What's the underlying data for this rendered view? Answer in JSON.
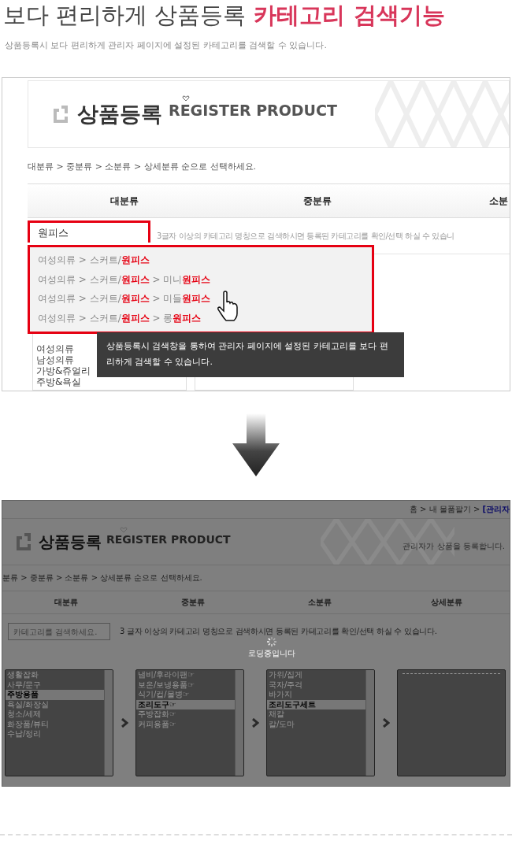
{
  "headline": {
    "text": "보다 편리하게 상품등록",
    "highlight": "카테고리 검색기능"
  },
  "subtitle": "상품등록시 보다 편리하게 관리자 페이지에 설정된 카테고리를 검색할 수 있습니다.",
  "before": {
    "brand_title": "상품등록",
    "brand_subtitle": "REGISTER PRODUCT",
    "instruction": "대분류 > 중분류 > 소분류 > 상세분류 순으로 선택하세요.",
    "columns": [
      "대분류",
      "중분류",
      "소분"
    ],
    "search": {
      "value": "원피스"
    },
    "hint": "3글자 이상의 카테고리 명칭으로 검색하시면 등록된 카테고리를 확인/선택 하실 수 있습니",
    "suggestions": [
      "여성의류 > 스커트/**원피스**",
      "여성의류 > 스커트/**원피스** > 미니**원피스**",
      "여성의류 > 스커트/**원피스** > 미들**원피스**",
      "여성의류 > 스커트/**원피스** > 롱**원피스**"
    ],
    "list_items": [
      "여성의류",
      "남성의류",
      "가방&쥬얼리",
      "주방&욕실"
    ],
    "tooltip": "상품등록시 검색창을 통하여 관리자 페이지에 설정된 카테고리를 보다 편리하게 검색할 수 있습니다."
  },
  "after": {
    "top_path": "홈 > 내 물품팔기 >",
    "top_link": "[관리자",
    "brand_title": "상품등록",
    "brand_subtitle": "REGISTER PRODUCT",
    "brand_note": "관리자가 상품을 등록합니다.",
    "instruction": "분류 > 중분류 > 소분류 > 상세분류 순으로 선택하세요.",
    "columns": [
      "대분류",
      "중분류",
      "소분류",
      "상세분류"
    ],
    "search": {
      "placeholder": "카테고리를 검색하세요."
    },
    "hint": "3 글자 이상의 카테고리 명칭으로 검색하시면 등록된 카테고리를 확인/선택 하실 수 있습니다.",
    "loading": "로딩중입니다",
    "lists": [
      [
        {
          "label": "생활잡화",
          "selected": false
        },
        {
          "label": "사무/문구",
          "selected": false
        },
        {
          "label": "주방용품",
          "selected": true
        },
        {
          "label": "욕실/화장실",
          "selected": false
        },
        {
          "label": "청소/세제",
          "selected": false
        },
        {
          "label": "화장품/뷰티",
          "selected": false
        },
        {
          "label": "수납/정리",
          "selected": false
        }
      ],
      [
        {
          "label": "냄비/후라이팬☞",
          "selected": false
        },
        {
          "label": "보온/보냉용품☞",
          "selected": false
        },
        {
          "label": "식기/컵/물병☞",
          "selected": false
        },
        {
          "label": "조리도구☞",
          "selected": true
        },
        {
          "label": "주방잡화☞",
          "selected": false
        },
        {
          "label": "커피용품☞",
          "selected": false
        }
      ],
      [
        {
          "label": "가위/집게",
          "selected": false
        },
        {
          "label": "국자/주걱",
          "selected": false
        },
        {
          "label": "바가지",
          "selected": false
        },
        {
          "label": "조리도구세트",
          "selected": true
        },
        {
          "label": "채칼",
          "selected": false
        },
        {
          "label": "칼/도마",
          "selected": false
        }
      ],
      [
        {
          "kind": "divider"
        }
      ]
    ]
  }
}
